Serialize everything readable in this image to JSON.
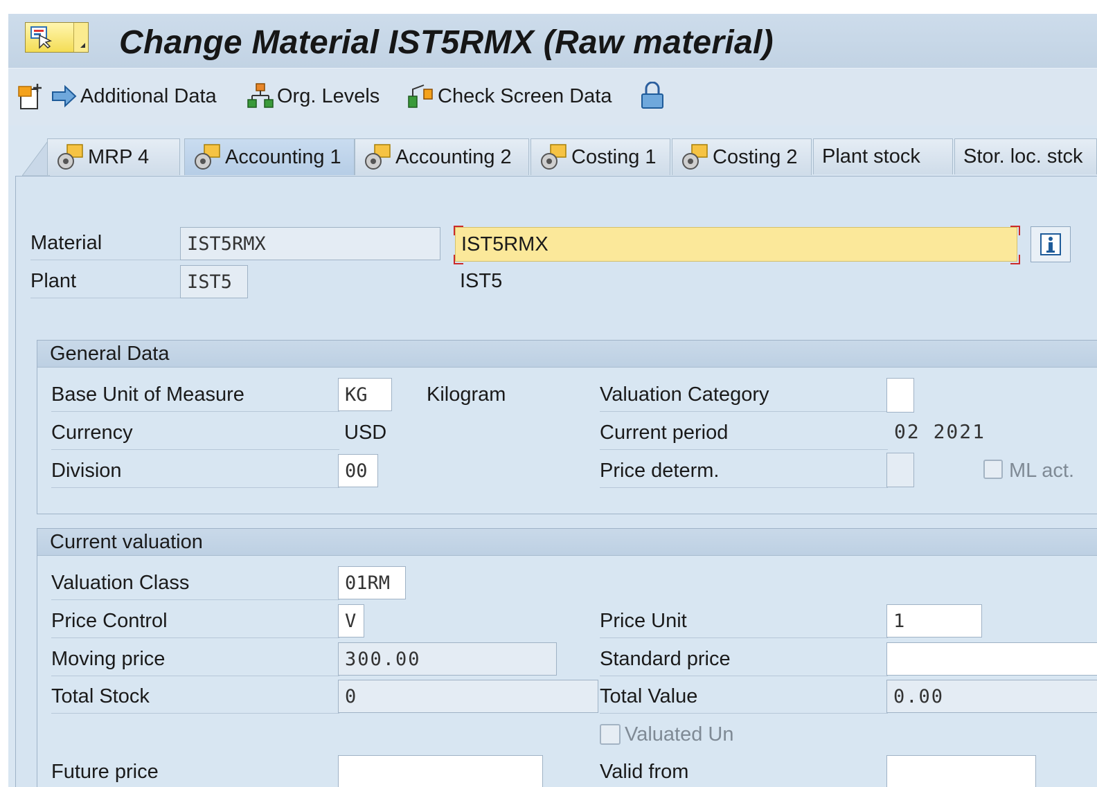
{
  "window": {
    "title": "Change Material IST5RMX (Raw material)"
  },
  "toolbar": {
    "additional_data": "Additional Data",
    "org_levels": "Org. Levels",
    "check_screen_data": "Check Screen Data"
  },
  "tabs": [
    {
      "label": "MRP 4",
      "icon": "gear-sheet-icon"
    },
    {
      "label": "Accounting 1",
      "icon": "gear-sheet-icon",
      "active": true
    },
    {
      "label": "Accounting 2",
      "icon": "gear-sheet-icon"
    },
    {
      "label": "Costing 1",
      "icon": "gear-sheet-icon"
    },
    {
      "label": "Costing 2",
      "icon": "gear-sheet-icon"
    },
    {
      "label": "Plant stock"
    },
    {
      "label": "Stor. loc. stck"
    }
  ],
  "header": {
    "material_label": "Material",
    "material_value": "IST5RMX",
    "material_description": "IST5RMX",
    "plant_label": "Plant",
    "plant_value": "IST5",
    "plant_description": "IST5"
  },
  "general_data": {
    "title": "General Data",
    "base_uom_label": "Base Unit of Measure",
    "base_uom_value": "KG",
    "base_uom_text": "Kilogram",
    "valuation_category_label": "Valuation Category",
    "valuation_category_value": "",
    "currency_label": "Currency",
    "currency_value": "USD",
    "current_period_label": "Current period",
    "current_period_value": "02 2021",
    "division_label": "Division",
    "division_value": "00",
    "price_determ_label": "Price determ.",
    "price_determ_value": "",
    "ml_act_label": "ML act."
  },
  "current_valuation": {
    "title": "Current valuation",
    "valuation_class_label": "Valuation Class",
    "valuation_class_value": "01RM",
    "price_control_label": "Price Control",
    "price_control_value": "V",
    "price_unit_label": "Price Unit",
    "price_unit_value": "1",
    "moving_price_label": "Moving price",
    "moving_price_value": "300.00",
    "standard_price_label": "Standard price",
    "standard_price_value": "",
    "total_stock_label": "Total Stock",
    "total_stock_value": "0",
    "total_value_label": "Total Value",
    "total_value_value": "0.00",
    "valuated_un_label": "Valuated Un",
    "future_price_label": "Future price",
    "future_price_value": "",
    "valid_from_label": "Valid from",
    "valid_from_value": ""
  },
  "colors": {
    "background": "#d9e6f2",
    "highlight_field": "#fbe89a",
    "required_marker": "#cc2a2a"
  }
}
